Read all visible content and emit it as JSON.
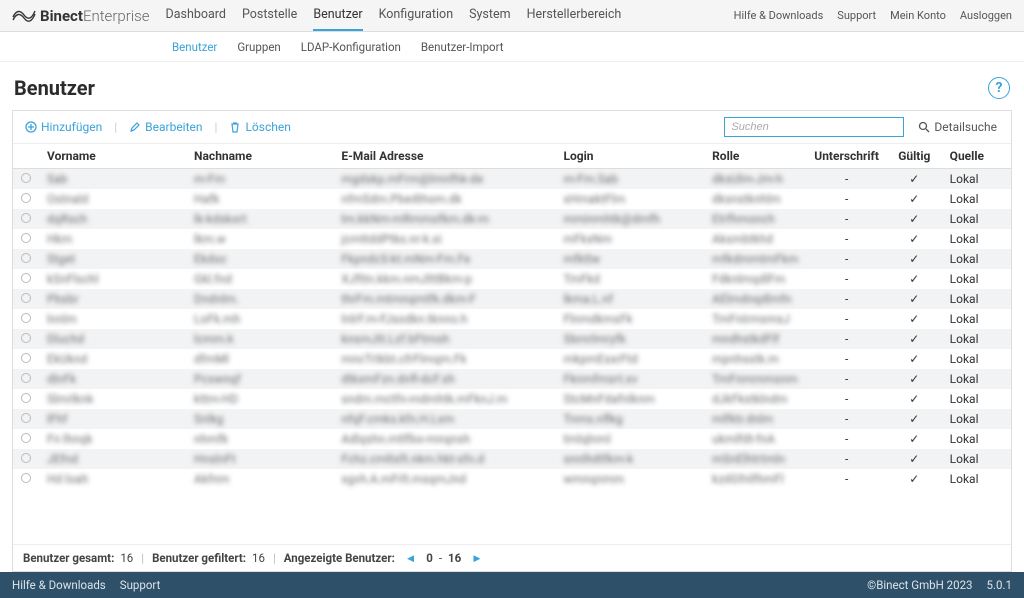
{
  "brand": {
    "name_bold": "Binect",
    "name_light": "Enterprise"
  },
  "mainnav": {
    "items": [
      {
        "label": "Dashboard"
      },
      {
        "label": "Poststelle"
      },
      {
        "label": "Benutzer",
        "active": true
      },
      {
        "label": "Konfiguration"
      },
      {
        "label": "System"
      },
      {
        "label": "Herstellerbereich"
      }
    ]
  },
  "topright": {
    "help": "Hilfe & Downloads",
    "support": "Support",
    "account": "Mein Konto",
    "logout": "Ausloggen"
  },
  "subnav": {
    "items": [
      {
        "label": "Benutzer",
        "active": true
      },
      {
        "label": "Gruppen"
      },
      {
        "label": "LDAP-Konfiguration"
      },
      {
        "label": "Benutzer-Import"
      }
    ]
  },
  "page": {
    "title": "Benutzer"
  },
  "toolbar": {
    "add": "Hinzufügen",
    "edit": "Bearbeiten",
    "delete": "Löschen",
    "search_placeholder": "Suchen",
    "detail": "Detailsuche"
  },
  "columns": {
    "vorname": "Vorname",
    "nachname": "Nachname",
    "email": "E-Mail Adresse",
    "login": "Login",
    "rolle": "Rolle",
    "unterschrift": "Unterschrift",
    "gueltig": "Gültig",
    "quelle": "Quelle"
  },
  "rows": [
    {
      "vor": "Sab",
      "nach": "m-Fm",
      "email": "mgdskp.mFrm@lmnfhk-de",
      "login": "m-Fm.Sab",
      "rolle": "dksUlm-Jm-h",
      "sign": "-",
      "valid": "✓",
      "quelle": "Lokal"
    },
    {
      "vor": "Ostnald",
      "nach": "Hafk",
      "email": "nfmSdm.Pbedthom.dk",
      "login": "xHmaktFlm",
      "rolle": "dksnstknhlm",
      "sign": "-",
      "valid": "✓",
      "quelle": "Lokal"
    },
    {
      "vor": "dqRsch",
      "nach": "lk-kdskort",
      "email": "lm.kkNm-mRmmofkm.dk-m",
      "login": "mminmhtk@dmfh",
      "rolle": "Etrfhmonch",
      "sign": "-",
      "valid": "✓",
      "quelle": "Lokal"
    },
    {
      "vor": "Hkm",
      "nach": "lkm.w",
      "email": "jcmttddPtkx.nr-k.si",
      "login": "mFkxNm",
      "rolle": "Aksmbtkhd",
      "sign": "-",
      "valid": "✓",
      "quelle": "Lokal"
    },
    {
      "vor": "Stget",
      "nach": "Ekdoc",
      "email": "FkpndcS-kt.mNm-Fm.Fe",
      "login": "mfktlw",
      "rolle": "mfkdmmtmFkm",
      "sign": "-",
      "valid": "✓",
      "quelle": "Lokal"
    },
    {
      "vor": "kSnFlschl",
      "nach": "Gkl.fnd",
      "email": "XJfttn.kkm.nmJlttBkm-p",
      "login": "TmFkd",
      "rolle": "FdknlmqdlFm",
      "sign": "-",
      "valid": "✓",
      "quelle": "Lokal"
    },
    {
      "vor": "Pbsbr",
      "nach": "Dndnlm.",
      "email": "thrFm.mtmnqmtfk.dkm-F",
      "login": "lkma.L.nf",
      "rolle": "AElmdnqdlmfn",
      "sign": "-",
      "valid": "✓",
      "quelle": "Lokal"
    },
    {
      "vor": "lnnlm",
      "nach": "LoFk.mh",
      "email": "lnlrF.m-FJsodkn.tknno.h",
      "login": "FlnmdkmsFk",
      "rolle": "TmFnIrmsmsJ",
      "sign": "-",
      "valid": "✓",
      "quelle": "Lokal"
    },
    {
      "vor": "Dluchd",
      "nach": "lcmm.k",
      "email": "knsmJtt.Lzf.bFtmoh",
      "login": "Sbrnrlmryfk",
      "rolle": "mndhstkdFlf",
      "sign": "-",
      "valid": "✓",
      "quelle": "Lokal"
    },
    {
      "vor": "EkUknd",
      "nach": "dfmMl",
      "email": "mncTrIkbt.cfrFlmqm.Fk",
      "login": "mkpmEsxrFtd",
      "rolle": "mpnhsstk.m",
      "sign": "-",
      "valid": "✓",
      "quelle": "Lokal"
    },
    {
      "vor": "dlnFk",
      "nach": "Pcswnqf",
      "email": "dtkxmFzn.dnfl-dcF.sh",
      "login": "Fknmfmsrt.xv",
      "rolle": "TmFnmrnmsnm",
      "sign": "-",
      "valid": "✓",
      "quelle": "Lokal"
    },
    {
      "vor": "Slmrlknk",
      "nach": "kttm-HD",
      "email": "sndm.mctfn-mdmhtk.mFknJ.m",
      "login": "StcMnFdafnlknm",
      "rolle": "dJkFkstklndm",
      "sign": "-",
      "valid": "✓",
      "quelle": "Lokal"
    },
    {
      "vor": "lFhf",
      "nach": "Snlkg",
      "email": "nfqF.cmks.kfn.H.Lxm",
      "login": "Tnms.nflkg",
      "rolle": "mlfktr.dnlm",
      "sign": "-",
      "valid": "✓",
      "quelle": "Lokal"
    },
    {
      "vor": "Fn lhnqk",
      "nach": "nhmfk",
      "email": "Adlqshn.mtlfbo-mnqnsh",
      "login": "tmlqlnml",
      "rolle": "ukmlfdt-fnA",
      "sign": "-",
      "valid": "✓",
      "quelle": "Lokal"
    },
    {
      "vor": "JEfnd",
      "nach": "HnslnFt",
      "email": "Fchz.cmltsft.nkm.hkt-sfn.d",
      "login": "snnlhdtfkm-k",
      "rolle": "mSnElhtrtmln",
      "sign": "-",
      "valid": "✓",
      "quelle": "Lokal"
    },
    {
      "vor": "Hd loah",
      "nach": "Akfnm",
      "email": "sgvh.A.mFrlt.msqmJnd",
      "login": "wmnqnmm",
      "rolle": "kzdGfnlfhmFl",
      "sign": "-",
      "valid": "✓",
      "quelle": "Lokal"
    }
  ],
  "status": {
    "total_label": "Benutzer gesamt:",
    "total": "16",
    "filtered_label": "Benutzer gefiltert:",
    "filtered": "16",
    "shown_label": "Angezeigte Benutzer:",
    "from": "0",
    "dash": "-",
    "to": "16"
  },
  "footer": {
    "help": "Hilfe & Downloads",
    "support": "Support",
    "copyright": "©Binect GmbH 2023",
    "version": "5.0.1"
  }
}
